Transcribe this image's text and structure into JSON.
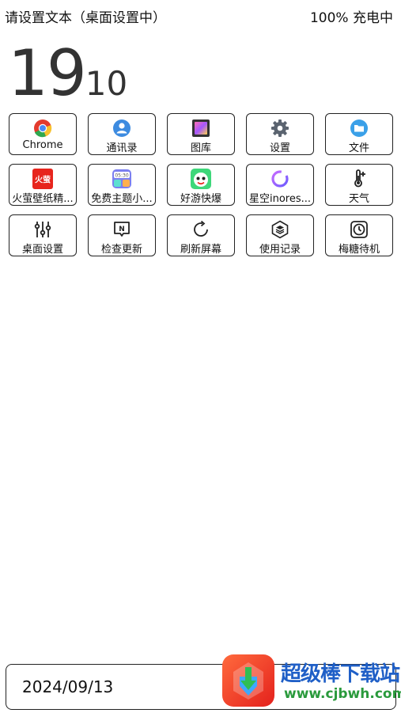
{
  "status_bar": {
    "left_text": "请设置文本（桌面设置中）",
    "right_text": "100% 充电中"
  },
  "clock": {
    "hours": "19",
    "minutes": "10"
  },
  "apps": [
    [
      {
        "label": "Chrome",
        "icon": "chrome-icon"
      },
      {
        "label": "通讯录",
        "icon": "contacts-icon"
      },
      {
        "label": "图库",
        "icon": "gallery-icon"
      },
      {
        "label": "设置",
        "icon": "settings-gear-icon"
      },
      {
        "label": "文件",
        "icon": "folder-icon"
      }
    ],
    [
      {
        "label": "火萤壁纸精...",
        "icon": "firefly-wallpaper-icon",
        "icon_text": "火萤"
      },
      {
        "label": "免费主题小...",
        "icon": "free-theme-icon",
        "icon_text": "05:30"
      },
      {
        "label": "好游快爆",
        "icon": "haoyou-kuaibao-icon"
      },
      {
        "label": "星空inores...",
        "icon": "starry-sky-icon"
      },
      {
        "label": "天气",
        "icon": "thermometer-icon"
      }
    ],
    [
      {
        "label": "桌面设置",
        "icon": "sliders-icon"
      },
      {
        "label": "检查更新",
        "icon": "update-check-icon",
        "icon_text": "N"
      },
      {
        "label": "刷新屏幕",
        "icon": "refresh-icon"
      },
      {
        "label": "使用记录",
        "icon": "usage-layers-icon"
      },
      {
        "label": "梅糖待机",
        "icon": "clock-icon"
      }
    ]
  ],
  "date_widget": {
    "date": "2024/09/13"
  },
  "watermark": {
    "brand_text": "超级棒下载站",
    "site_text": "www.cjbwh.com",
    "icon": "download-logo-icon"
  },
  "colors": {
    "chrome_red": "#e33b2e",
    "chrome_yellow": "#f7c22d",
    "chrome_green": "#2fa84f",
    "chrome_blue": "#4a8af4",
    "accent_blue": "#3d8be0",
    "firefly_red": "#e7251d",
    "watermark_blue": "#1f5fc7",
    "watermark_green": "#2a9a3c"
  }
}
